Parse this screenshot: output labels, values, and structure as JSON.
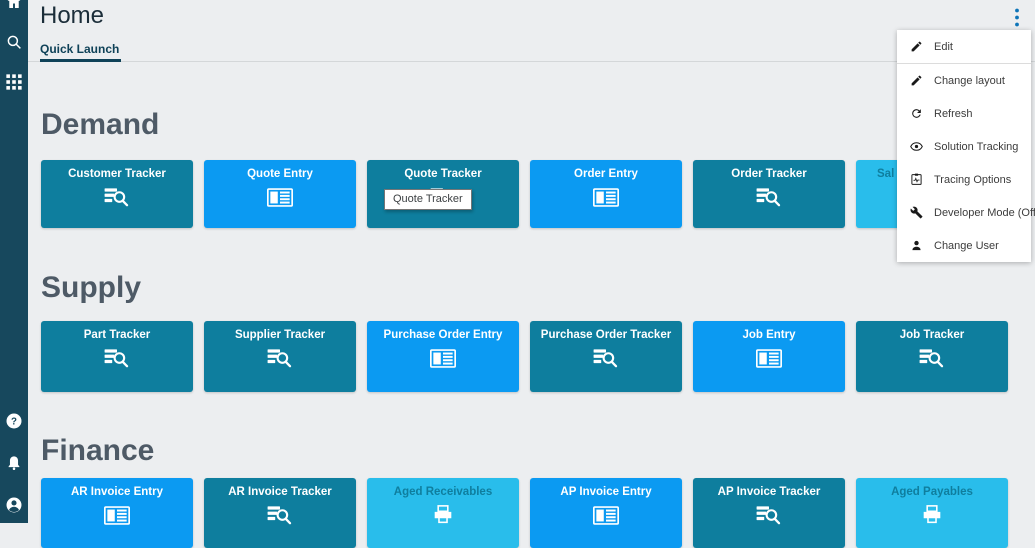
{
  "header": {
    "title": "Home"
  },
  "tabs": {
    "active": "Quick Launch"
  },
  "sidebar": {
    "top": [
      {
        "name": "home-icon"
      },
      {
        "name": "search-icon"
      },
      {
        "name": "apps-icon"
      }
    ],
    "bottom": [
      {
        "name": "help-icon"
      },
      {
        "name": "notifications-icon"
      },
      {
        "name": "account-icon"
      }
    ]
  },
  "sections": [
    {
      "title": "Demand",
      "tiles": [
        {
          "label": "Customer Tracker",
          "type": "tracker",
          "color": "teal"
        },
        {
          "label": "Quote Entry",
          "type": "entry",
          "color": "blue"
        },
        {
          "label": "Quote Tracker",
          "type": "tracker",
          "color": "teal"
        },
        {
          "label": "Order Entry",
          "type": "entry",
          "color": "blue"
        },
        {
          "label": "Order Tracker",
          "type": "tracker",
          "color": "teal"
        },
        {
          "label": "Sal",
          "type": "report",
          "color": "cyan",
          "clipped": true
        }
      ]
    },
    {
      "title": "Supply",
      "tiles": [
        {
          "label": "Part Tracker",
          "type": "tracker",
          "color": "teal"
        },
        {
          "label": "Supplier Tracker",
          "type": "tracker",
          "color": "teal"
        },
        {
          "label": "Purchase Order Entry",
          "type": "entry",
          "color": "blue"
        },
        {
          "label": "Purchase Order Tracker",
          "type": "tracker",
          "color": "teal"
        },
        {
          "label": "Job Entry",
          "type": "entry",
          "color": "blue"
        },
        {
          "label": "Job Tracker",
          "type": "tracker",
          "color": "teal"
        }
      ]
    },
    {
      "title": "Finance",
      "tiles": [
        {
          "label": "AR Invoice Entry",
          "type": "entry",
          "color": "blue"
        },
        {
          "label": "AR Invoice Tracker",
          "type": "tracker",
          "color": "teal"
        },
        {
          "label": "Aged Receivables",
          "type": "report",
          "color": "cyan"
        },
        {
          "label": "AP Invoice Entry",
          "type": "entry",
          "color": "blue"
        },
        {
          "label": "AP Invoice Tracker",
          "type": "tracker",
          "color": "teal"
        },
        {
          "label": "Aged Payables",
          "type": "report",
          "color": "cyan"
        }
      ]
    }
  ],
  "menu": {
    "items": [
      {
        "label": "Edit",
        "icon": "pencil-icon",
        "divider_after": true
      },
      {
        "label": "Change layout",
        "icon": "pencil-icon"
      },
      {
        "label": "Refresh",
        "icon": "refresh-icon"
      },
      {
        "label": "Solution Tracking",
        "icon": "eye-icon"
      },
      {
        "label": "Tracing Options",
        "icon": "tracing-icon"
      },
      {
        "label": "Developer Mode (Off)",
        "icon": "wrench-icon"
      },
      {
        "label": "Change User",
        "icon": "user-icon"
      }
    ]
  },
  "tooltip": {
    "text": "Quote Tracker"
  },
  "colors": {
    "sidebar": "#17485D",
    "teal": "#0E7E9E",
    "blue": "#0B9AF2",
    "cyan": "#29BDEB",
    "cyan_text": "#0F7E9E",
    "background": "#ECEEF0",
    "accent": "#0D74B8",
    "heading": "#4E5A66"
  }
}
